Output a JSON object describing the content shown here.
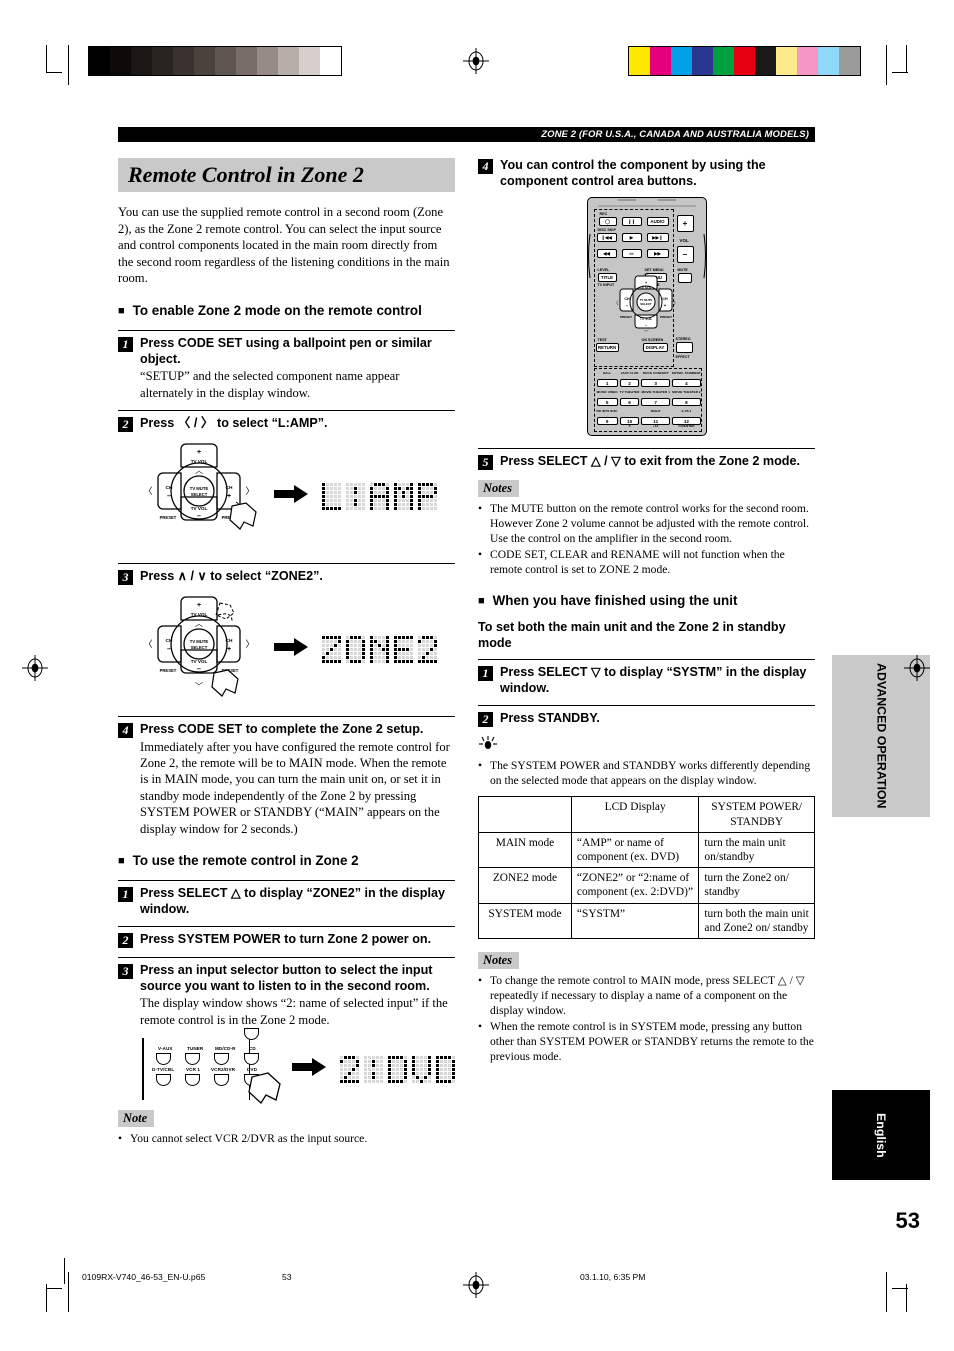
{
  "header": {
    "band_text": "ZONE 2 (FOR U.S.A., CANADA AND AUSTRALIA MODELS)"
  },
  "left": {
    "title": "Remote Control in Zone 2",
    "intro": "You can use the supplied remote control in a second room (Zone 2), as the Zone 2 remote control. You can select the input source and control components located in the main room directly from the second room regardless of the listening conditions in the main room.",
    "section_enable": "To enable Zone 2 mode on the remote control",
    "steps": [
      {
        "num": "1",
        "title": "Press CODE SET using a ballpoint pen or similar object.",
        "desc": "“SETUP” and the selected component name appear alternately in the display window."
      },
      {
        "num": "2",
        "title": "Press 〈 / 〉 to select “L:AMP”.",
        "lcd": "L:AMP"
      },
      {
        "num": "3",
        "title": "Press ∧ / ∨ to select “ZONE2”.",
        "lcd": "ZONE2"
      },
      {
        "num": "4",
        "title": "Press CODE SET to complete the Zone 2 setup.",
        "desc": "Immediately after you have configured the remote control for Zone 2, the remote will be to MAIN mode. When the remote is in MAIN mode, you can turn the main unit on, or set it in standby mode independently of the Zone 2 by pressing SYSTEM POWER or STANDBY (“MAIN” appears on the display window for 2 seconds.)"
      }
    ],
    "section_use": "To use the remote control in Zone 2",
    "use_steps": [
      {
        "num": "1",
        "title": "Press SELECT △ to display “ZONE2” in the display window."
      },
      {
        "num": "2",
        "title": "Press SYSTEM POWER to turn Zone 2 power on."
      },
      {
        "num": "3",
        "title": "Press an input selector button to select the input source you want to listen to in the second room.",
        "desc": "The display window shows “2: name of selected input” if the remote control is in the Zone 2 mode.",
        "lcd": "2:DVD"
      }
    ],
    "selector_buttons": [
      "V-AUX",
      "TUNER",
      "MD/CD-R",
      "CD",
      "D-TV/CBL",
      "VCR 1",
      "VCR2/DVR",
      "DVD"
    ],
    "note_tag": "Note",
    "note_items": [
      "You cannot select VCR 2/DVR as the input source."
    ]
  },
  "right": {
    "step4": {
      "num": "4",
      "title": "You can control the component by using the component control area buttons."
    },
    "step5": {
      "num": "5",
      "title": "Press SELECT △ / ▽ to exit from the Zone 2 mode."
    },
    "notes_tag_1": "Notes",
    "notes_1": [
      "The MUTE button on the remote control works for the second room. However Zone 2 volume cannot be adjusted with the remote control. Use the control on the amplifier in the second room.",
      "CODE SET, CLEAR and RENAME will not function when the remote control is set to ZONE 2 mode."
    ],
    "section_finished": "When you have finished using the unit",
    "subhead_standby": "To set both the main unit and the Zone 2 in standby mode",
    "standby_steps": [
      {
        "num": "1",
        "title": "Press SELECT ▽ to display “SYSTM” in the display window."
      },
      {
        "num": "2",
        "title": "Press STANDBY."
      }
    ],
    "tip_items": [
      "The SYSTEM POWER and STANDBY works differently depending on the selected mode that appears on the display window."
    ],
    "table": {
      "headers": [
        "",
        "LCD Display",
        "SYSTEM POWER/ STANDBY"
      ],
      "rows": [
        {
          "mode": "MAIN mode",
          "lcd": "“AMP” or name of component (ex. DVD)",
          "power": "turn the main unit on/standby"
        },
        {
          "mode": "ZONE2 mode",
          "lcd": "“ZONE2” or “2:name of component (ex. 2:DVD)”",
          "power": "turn the Zone2 on/ standby"
        },
        {
          "mode": "SYSTEM mode",
          "lcd": "“SYSTM”",
          "power": "turn both the main unit and Zone2 on/ standby"
        }
      ]
    },
    "notes_tag_2": "Notes",
    "notes_2": [
      "To change the remote control to MAIN mode, press SELECT △ / ▽ repeatedly if necessary to display a name of a component on the display window.",
      "When the remote control is in SYSTEM mode, pressing any button other than SYSTEM POWER or STANDBY returns the remote to the previous mode."
    ]
  },
  "remote": {
    "transport_labels": {
      "rec": "REC",
      "disc_skip": "DISC SKIP",
      "audio": "AUDIO"
    },
    "vol_plus": "+",
    "vol_label": "VOL",
    "vol_minus": "–",
    "mute_label": "MUTE",
    "middle": {
      "level": "LEVEL",
      "title_btn": "TITLE",
      "tv_input": "TV INPUT",
      "set_menu": "SET MENU",
      "menu_btn": "MENU",
      "abcde": "A/B/C/D/E",
      "tv_vol_up": "TV VOL",
      "tv_vol_down": "TV VOL",
      "ch_up": "CH",
      "ch_down": "CH",
      "preset_left": "PRESET",
      "preset_right": "PRESET",
      "center": "TV MUTE SELECT",
      "test": "TEST",
      "return_btn": "RETURN",
      "on_screen": "ON SCREEN",
      "display_btn": "DISPLAY",
      "stereo": "STEREO",
      "effect": "EFFECT"
    },
    "keypad": [
      {
        "num": "1",
        "top": "HALL",
        "bottom": ""
      },
      {
        "num": "2",
        "top": "JAZZ CLUB",
        "bottom": ""
      },
      {
        "num": "3",
        "top": "ROCK CONCERT",
        "bottom": ""
      },
      {
        "num": "4",
        "top": "ENTER- TAINMENT",
        "bottom": ""
      },
      {
        "num": "5",
        "top": "MUSIC VIDEO",
        "bottom": ""
      },
      {
        "num": "6",
        "top": "TV THEATER",
        "bottom": ""
      },
      {
        "num": "7",
        "top": "MOVIE THEATER 1",
        "bottom": ""
      },
      {
        "num": "8",
        "top": "MOVIE THEATER 2",
        "bottom": ""
      },
      {
        "num": "9",
        "top": "DD /DTS SUR.",
        "bottom": ""
      },
      {
        "num": "10",
        "top": "",
        "bottom": "0"
      },
      {
        "num": "11",
        "top": "NIGHT",
        "bottom": "+10"
      },
      {
        "num": "12",
        "top": "6.1/5.1",
        "bottom": "CH/ENTER"
      }
    ]
  },
  "side_tabs": {
    "advanced": "ADVANCED OPERATION",
    "english": "English"
  },
  "page_number": "53",
  "footer": {
    "file": "0109RX-V740_46-53_EN-U.p65",
    "page": "53",
    "date": "03.1.10, 6:35 PM"
  },
  "calibration": {
    "grayscale": [
      "#000000",
      "#0d0b0a",
      "#1a1715",
      "#2a2421",
      "#3a322e",
      "#4b423d",
      "#5f554f",
      "#776c66",
      "#968b85",
      "#b8aea9",
      "#d6cfcb",
      "#ffffff"
    ],
    "colors": [
      "#ffe800",
      "#e5007e",
      "#00a0e9",
      "#2b3690",
      "#00a040",
      "#e60012",
      "#1a1a1a",
      "#fbe98b",
      "#f497c4",
      "#8fd8f7",
      "#9b9b9b"
    ]
  }
}
